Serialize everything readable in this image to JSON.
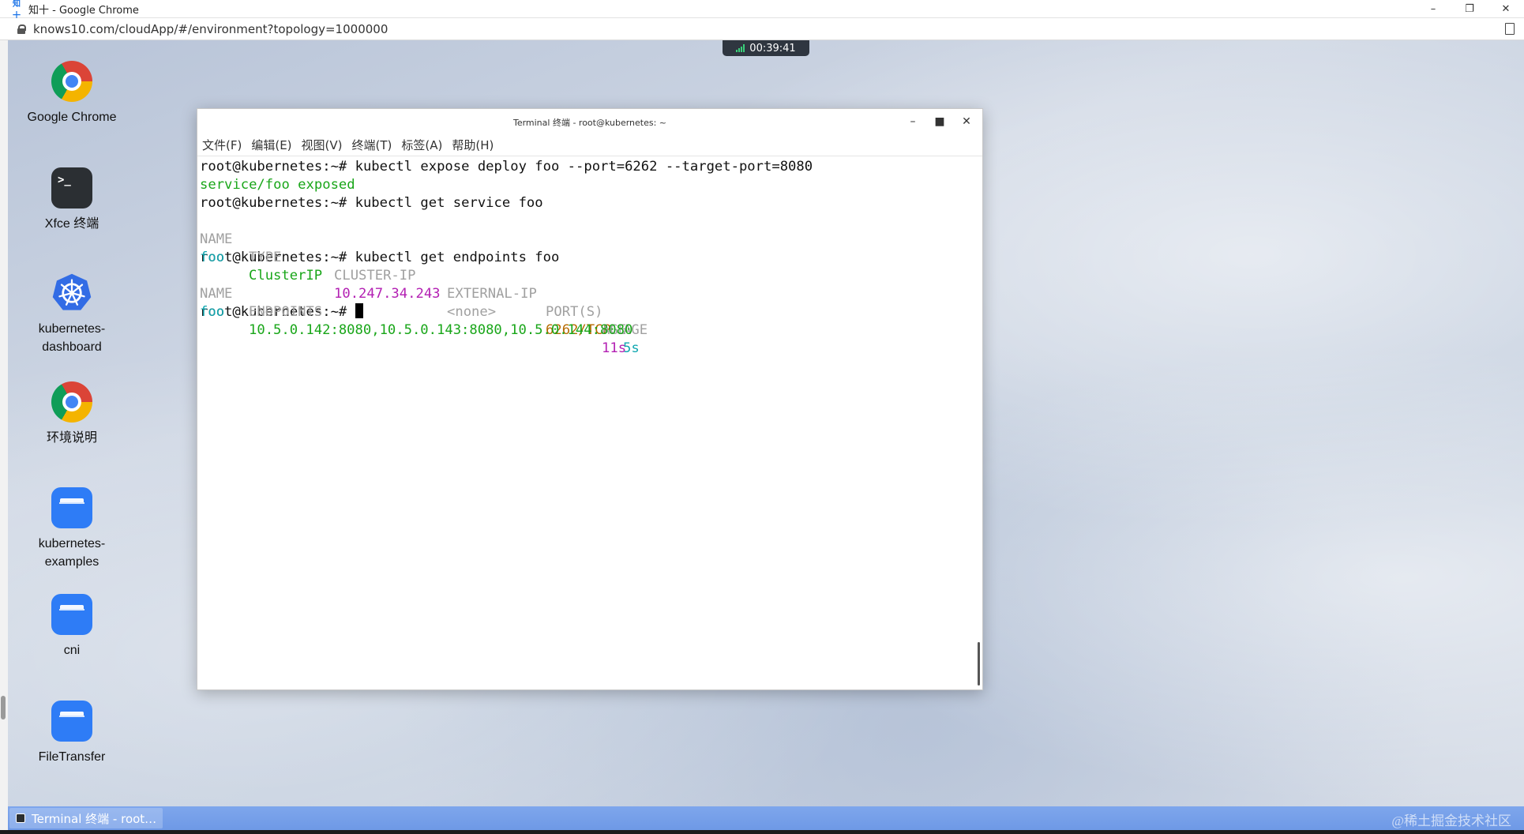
{
  "browser": {
    "favicon_text": "知十",
    "window_title": "知十 - Google Chrome",
    "url": "knows10.com/cloudApp/#/environment?topology=1000000"
  },
  "session": {
    "timer": "00:39:41"
  },
  "desktop_icons": [
    {
      "label": "Google Chrome",
      "icon": "chrome-icon"
    },
    {
      "label": "Xfce 终端",
      "icon": "terminal-icon"
    },
    {
      "label": "kubernetes-\ndashboard",
      "icon": "kubernetes-icon"
    },
    {
      "label": "环境说明",
      "icon": "chrome-icon"
    },
    {
      "label": "kubernetes-\nexamples",
      "icon": "folder-icon"
    },
    {
      "label": "cni",
      "icon": "folder-icon"
    },
    {
      "label": "FileTransfer",
      "icon": "folder-icon"
    }
  ],
  "terminal": {
    "title": "Terminal 终端 - root@kubernetes: ~",
    "menu": [
      "文件(F)",
      "编辑(E)",
      "视图(V)",
      "终端(T)",
      "标签(A)",
      "帮助(H)"
    ],
    "prompt": "root@kubernetes:~# ",
    "cmd1": "kubectl expose deploy foo --port=6262 --target-port=8080",
    "out1": "service/foo exposed",
    "cmd2": "kubectl get service foo",
    "svc_headers": [
      "NAME",
      "TYPE",
      "CLUSTER-IP",
      "EXTERNAL-IP",
      "PORT(S)",
      "AGE"
    ],
    "svc_row": [
      "foo",
      "ClusterIP",
      "10.247.34.243",
      "<none>",
      "6262/TCP",
      "5s"
    ],
    "cmd3": "kubectl get endpoints foo",
    "ep_headers": [
      "NAME",
      "ENDPOINTS",
      "AGE"
    ],
    "ep_row": [
      "foo",
      "10.5.0.142:8080,10.5.0.143:8080,10.5.0.144:8080",
      "11s"
    ]
  },
  "taskbar": {
    "item": "Terminal 终端 - root…"
  },
  "watermark": "@稀土掘金技术社区",
  "colors": {
    "taskbar": "#7ea6ec",
    "term_green": "#19a619",
    "term_cyan": "#10a7b0",
    "term_magenta": "#b320b3",
    "term_orange": "#b66a00"
  }
}
